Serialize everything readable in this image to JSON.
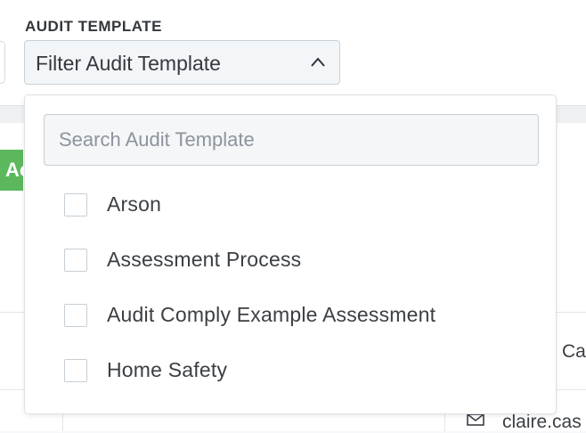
{
  "filter": {
    "label": "AUDIT TEMPLATE",
    "select_value": "Filter Audit Template",
    "search_placeholder": "Search Audit Template",
    "options": [
      {
        "label": "Arson",
        "checked": false
      },
      {
        "label": "Assessment Process",
        "checked": false
      },
      {
        "label": "Audit Comply Example Assessment",
        "checked": false
      },
      {
        "label": "Home Safety",
        "checked": false
      }
    ]
  },
  "background": {
    "green_button_text": "Ac",
    "row_text_1": "Ca",
    "row_text_2": "claire.cas"
  },
  "colors": {
    "accent_green": "#5cb85c",
    "select_bg": "#f3f6f8",
    "border": "#c7ced4"
  }
}
